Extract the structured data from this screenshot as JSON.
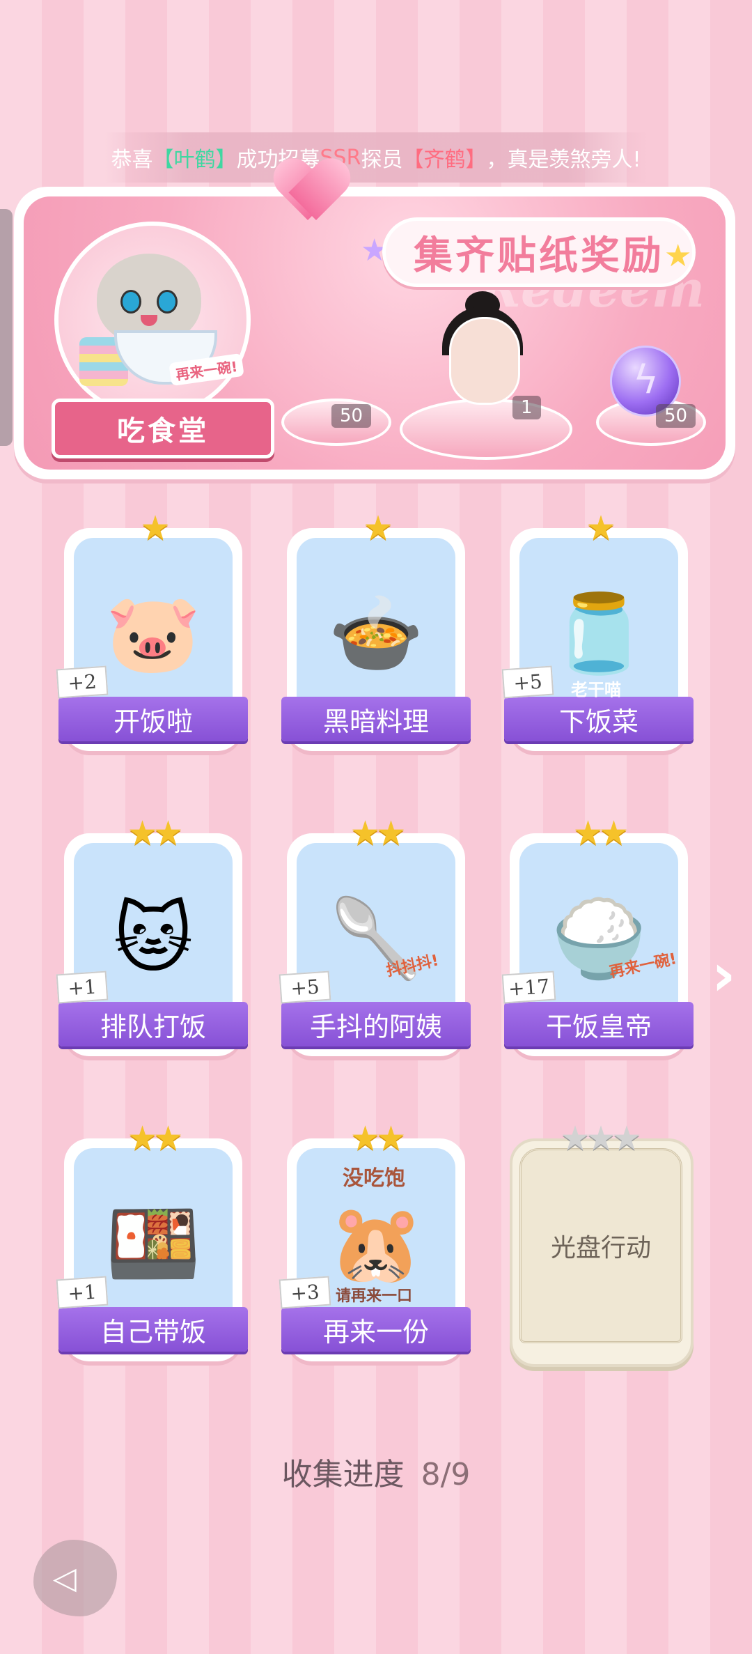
{
  "marquee": {
    "prefix": "恭喜",
    "name1": "【叶鹤】",
    "mid1": "成功招募",
    "ssr": "SSR",
    "mid2": "探员",
    "name2": "【齐鹤】",
    "suffix": "，真是羡煞旁人!"
  },
  "banner": {
    "title": "集齐贴纸奖励",
    "watermark": "Redeem",
    "ribbon_label": "吃食堂",
    "cat_tag": "再来一碗!",
    "rewards": [
      {
        "icon": "heart-gem-icon",
        "count": "50"
      },
      {
        "icon": "character-portrait",
        "count": "1"
      },
      {
        "icon": "lightning-orb-icon",
        "count": "50"
      }
    ]
  },
  "stickers": [
    {
      "label": "开饭啦",
      "stars": 1,
      "badge": "+2",
      "icon": "pig-icon"
    },
    {
      "label": "黑暗料理",
      "stars": 1,
      "badge": "",
      "icon": "dark-dish-icon"
    },
    {
      "label": "下饭菜",
      "stars": 1,
      "badge": "+5",
      "icon": "chili-jar-icon",
      "jar_text": "老干喵"
    },
    {
      "label": "排队打饭",
      "stars": 2,
      "badge": "+1",
      "icon": "cats-queue-icon"
    },
    {
      "label": "手抖的阿姨",
      "stars": 2,
      "badge": "+5",
      "icon": "ladle-icon",
      "art_text": "抖抖抖!"
    },
    {
      "label": "干饭皇帝",
      "stars": 2,
      "badge": "+17",
      "icon": "cat-bowl-icon",
      "art_text": "再来一碗!"
    },
    {
      "label": "自己带饭",
      "stars": 2,
      "badge": "+1",
      "icon": "lunchbox-icon"
    },
    {
      "label": "再来一份",
      "stars": 2,
      "badge": "+3",
      "icon": "hamster-icon",
      "art_top": "没吃饱",
      "art_bottom": "请再来一口"
    },
    {
      "label": "光盘行动",
      "stars": 3,
      "badge": "",
      "icon": "locked-card",
      "locked": true
    }
  ],
  "progress": {
    "label": "收集进度",
    "value": "8/9",
    "collected": 8,
    "total": 9
  },
  "colors": {
    "accent_purple": "#8751d6",
    "banner_pink": "#f49ab5",
    "star_gold": "#f5c22a"
  }
}
